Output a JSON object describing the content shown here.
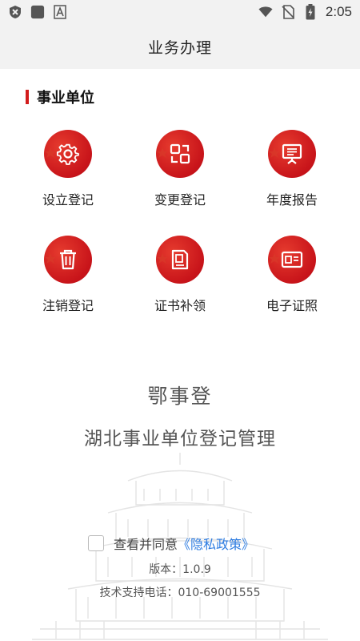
{
  "status_bar": {
    "time": "2:05",
    "left_icons": [
      "shield-x-icon",
      "square-app-icon",
      "font-a-icon"
    ],
    "right_icons": [
      "wifi-icon",
      "no-sim-icon",
      "battery-charging-icon"
    ]
  },
  "header": {
    "title": "业务办理"
  },
  "section": {
    "title": "事业单位",
    "accent_color": "#d21c1c"
  },
  "services": [
    {
      "label": "设立登记",
      "icon": "gear-icon"
    },
    {
      "label": "变更登记",
      "icon": "swap-squares-icon"
    },
    {
      "label": "年度报告",
      "icon": "presentation-board-icon"
    },
    {
      "label": "注销登记",
      "icon": "trash-icon"
    },
    {
      "label": "证书补领",
      "icon": "certificate-icon"
    },
    {
      "label": "电子证照",
      "icon": "id-card-icon"
    }
  ],
  "brand": {
    "name": "鄂事登",
    "subtitle": "湖北事业单位登记管理"
  },
  "consent": {
    "text": "查看并同意",
    "link": "《隐私政策》",
    "checked": false
  },
  "footer": {
    "version": "版本：1.0.9",
    "support": "技术支持电话：010-69001555"
  }
}
